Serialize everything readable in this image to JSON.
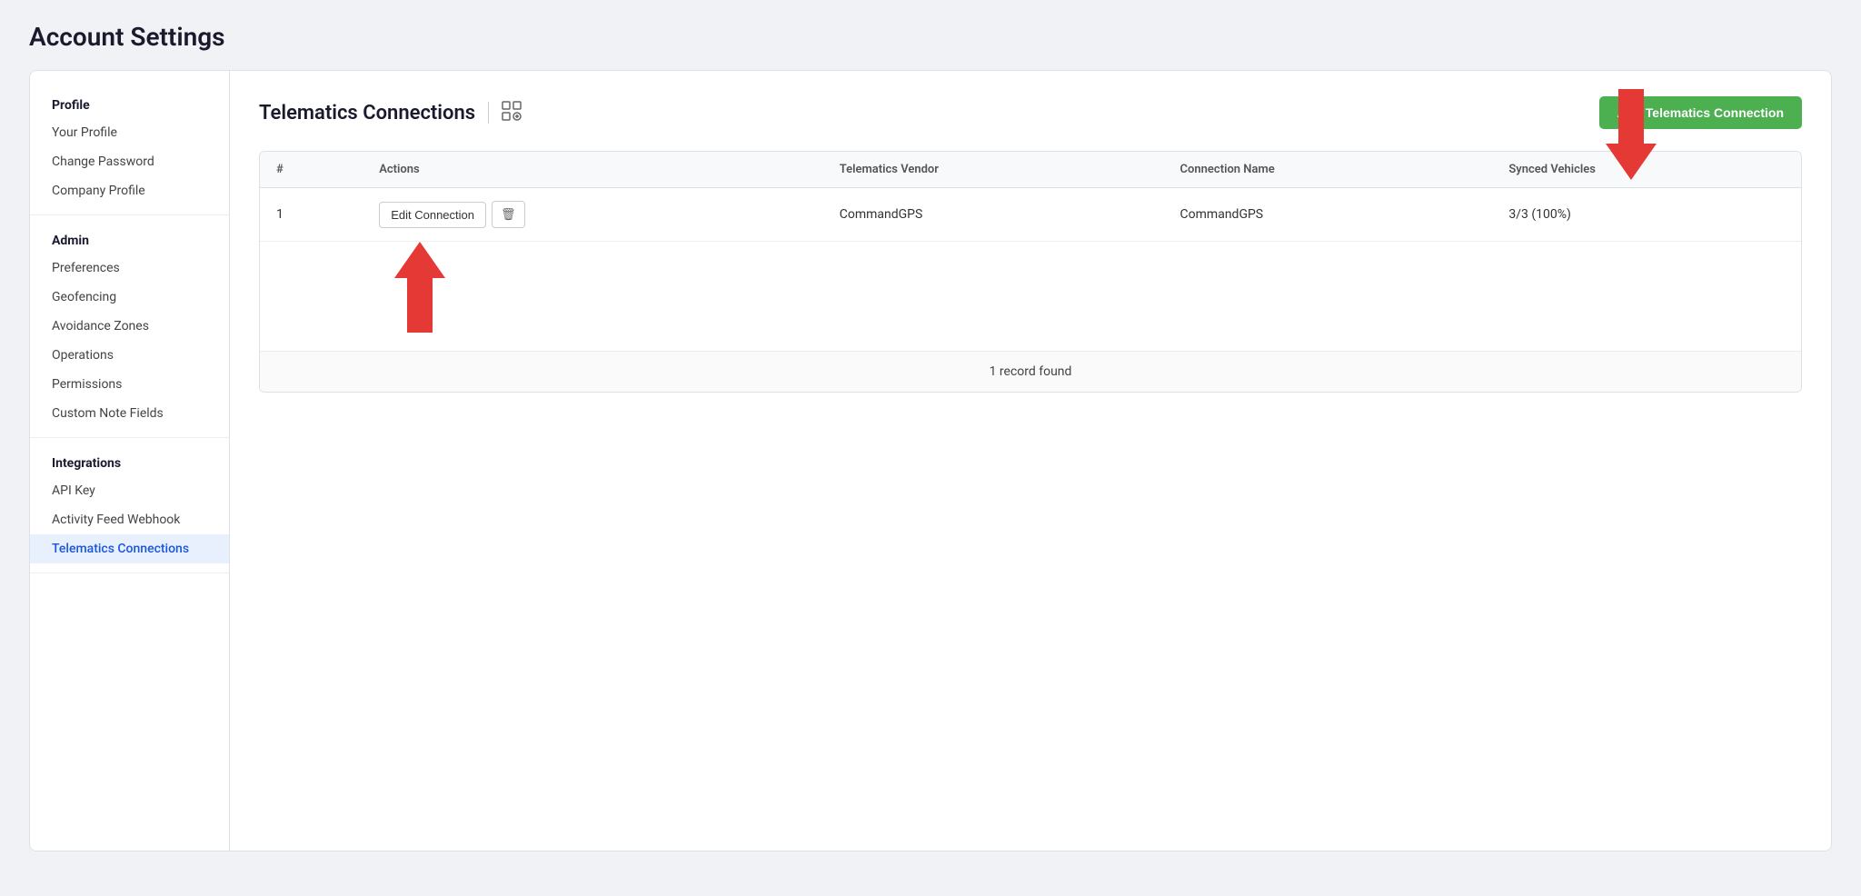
{
  "page": {
    "title": "Account Settings"
  },
  "sidebar": {
    "sections": [
      {
        "label": "Profile",
        "items": [
          {
            "id": "your-profile",
            "label": "Your Profile",
            "active": false
          },
          {
            "id": "change-password",
            "label": "Change Password",
            "active": false
          },
          {
            "id": "company-profile",
            "label": "Company Profile",
            "active": false
          }
        ]
      },
      {
        "label": "Admin",
        "items": [
          {
            "id": "preferences",
            "label": "Preferences",
            "active": false
          },
          {
            "id": "geofencing",
            "label": "Geofencing",
            "active": false
          },
          {
            "id": "avoidance-zones",
            "label": "Avoidance Zones",
            "active": false
          },
          {
            "id": "operations",
            "label": "Operations",
            "active": false
          },
          {
            "id": "permissions",
            "label": "Permissions",
            "active": false
          },
          {
            "id": "custom-note-fields",
            "label": "Custom Note Fields",
            "active": false
          }
        ]
      },
      {
        "label": "Integrations",
        "items": [
          {
            "id": "api-key",
            "label": "API Key",
            "active": false
          },
          {
            "id": "activity-feed-webhook",
            "label": "Activity Feed Webhook",
            "active": false
          },
          {
            "id": "telematics-connections",
            "label": "Telematics Connections",
            "active": true
          }
        ]
      }
    ]
  },
  "content": {
    "title": "Telematics Connections",
    "add_button_label": "Add Telematics Connection",
    "table": {
      "columns": [
        "#",
        "Actions",
        "Telematics Vendor",
        "Connection Name",
        "Synced Vehicles"
      ],
      "rows": [
        {
          "num": "1",
          "telematics_vendor": "CommandGPS",
          "connection_name": "CommandGPS",
          "synced_vehicles": "3/3 (100%)"
        }
      ],
      "edit_button_label": "Edit Connection",
      "delete_icon": "🗑",
      "record_count_label": "1 record found"
    }
  }
}
